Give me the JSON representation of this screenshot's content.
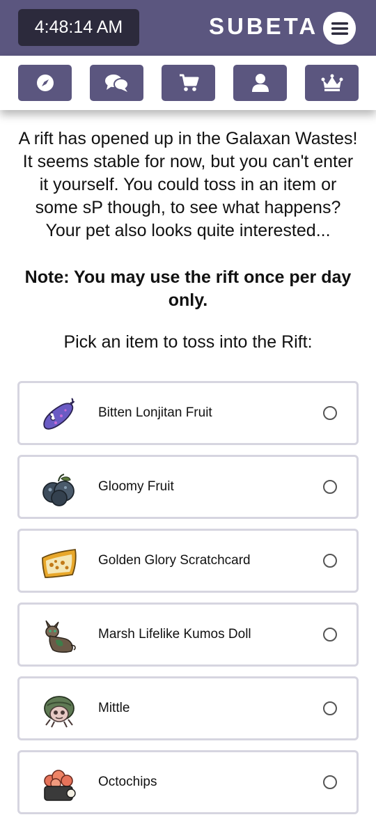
{
  "header": {
    "time": "4:48:14 AM",
    "brand": "SUBETA",
    "menu_icon": "hamburger-icon"
  },
  "nav": [
    {
      "icon": "compass-icon"
    },
    {
      "icon": "chat-icon"
    },
    {
      "icon": "cart-icon"
    },
    {
      "icon": "user-icon"
    },
    {
      "icon": "crown-icon"
    }
  ],
  "main": {
    "intro": "A rift has opened up in the Galaxan Wastes! It seems stable for now, but you can't enter it yourself. You could toss in an item or some sP though, to see what happens? Your pet also looks quite interested...",
    "note": "Note: You may use the rift once per day only.",
    "pick_prompt": "Pick an item to toss into the Rift:"
  },
  "items": [
    {
      "name": "Bitten Lonjitan Fruit",
      "icon": "bitten-fruit-icon"
    },
    {
      "name": "Gloomy Fruit",
      "icon": "gloomy-fruit-icon"
    },
    {
      "name": "Golden Glory Scratchcard",
      "icon": "scratchcard-icon"
    },
    {
      "name": "Marsh Lifelike Kumos Doll",
      "icon": "kumos-doll-icon"
    },
    {
      "name": "Mittle",
      "icon": "mittle-icon"
    },
    {
      "name": "Octochips",
      "icon": "octochips-icon"
    }
  ],
  "colors": {
    "brand": "#5b567f",
    "clock_bg": "#2c2a3c",
    "item_border": "#d6d5e0"
  }
}
